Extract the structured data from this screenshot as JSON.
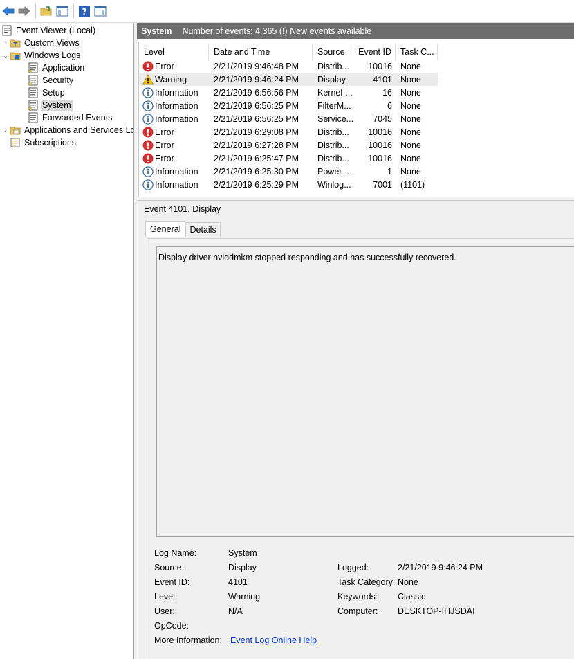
{
  "tree": {
    "root": "Event Viewer (Local)",
    "custom_views": "Custom Views",
    "windows_logs": "Windows Logs",
    "application": "Application",
    "security": "Security",
    "setup": "Setup",
    "system": "System",
    "forwarded": "Forwarded Events",
    "apps_services": "Applications and Services Lo",
    "subscriptions": "Subscriptions"
  },
  "header": {
    "title": "System",
    "count": "Number of events: 4,365 (!) New events available"
  },
  "columns": [
    "Level",
    "Date and Time",
    "Source",
    "Event ID",
    "Task C..."
  ],
  "events": [
    {
      "level": "Error",
      "icon": "error-icon",
      "datetime": "2/21/2019 9:46:48 PM",
      "source": "Distrib...",
      "event_id": "10016",
      "task": "None"
    },
    {
      "level": "Warning",
      "icon": "warning-icon",
      "datetime": "2/21/2019 9:46:24 PM",
      "source": "Display",
      "event_id": "4101",
      "task": "None"
    },
    {
      "level": "Information",
      "icon": "info-icon",
      "datetime": "2/21/2019 6:56:56 PM",
      "source": "Kernel-...",
      "event_id": "16",
      "task": "None"
    },
    {
      "level": "Information",
      "icon": "info-icon",
      "datetime": "2/21/2019 6:56:25 PM",
      "source": "FilterM...",
      "event_id": "6",
      "task": "None"
    },
    {
      "level": "Information",
      "icon": "info-icon",
      "datetime": "2/21/2019 6:56:25 PM",
      "source": "Service...",
      "event_id": "7045",
      "task": "None"
    },
    {
      "level": "Error",
      "icon": "error-icon",
      "datetime": "2/21/2019 6:29:08 PM",
      "source": "Distrib...",
      "event_id": "10016",
      "task": "None"
    },
    {
      "level": "Error",
      "icon": "error-icon",
      "datetime": "2/21/2019 6:27:28 PM",
      "source": "Distrib...",
      "event_id": "10016",
      "task": "None"
    },
    {
      "level": "Error",
      "icon": "error-icon",
      "datetime": "2/21/2019 6:25:47 PM",
      "source": "Distrib...",
      "event_id": "10016",
      "task": "None"
    },
    {
      "level": "Information",
      "icon": "info-icon",
      "datetime": "2/21/2019 6:25:30 PM",
      "source": "Power-...",
      "event_id": "1",
      "task": "None"
    },
    {
      "level": "Information",
      "icon": "info-icon",
      "datetime": "2/21/2019 6:25:29 PM",
      "source": "Winlog...",
      "event_id": "7001",
      "task": "(1101)"
    }
  ],
  "detail": {
    "title": "Event 4101, Display",
    "tab_general": "General",
    "tab_details": "Details",
    "message": "Display driver nvlddmkm stopped responding and has successfully recovered.",
    "labels": {
      "log_name": "Log Name:",
      "source": "Source:",
      "event_id": "Event ID:",
      "level": "Level:",
      "user": "User:",
      "opcode": "OpCode:",
      "more_info": "More Information:",
      "logged": "Logged:",
      "task_category": "Task Category:",
      "keywords": "Keywords:",
      "computer": "Computer:"
    },
    "values": {
      "log_name": "System",
      "source": "Display",
      "event_id": "4101",
      "level": "Warning",
      "user": "N/A",
      "more_info_link": "Event Log Online Help",
      "logged": "2/21/2019 9:46:24 PM",
      "task_category": "None",
      "keywords": "Classic",
      "computer": "DESKTOP-IHJSDAI"
    }
  },
  "colors": {
    "header_bg": "#6d6d6d",
    "error": "#d32f2f",
    "warning": "#f2c200",
    "info": "#3a6ea5",
    "link": "#0033cc"
  }
}
